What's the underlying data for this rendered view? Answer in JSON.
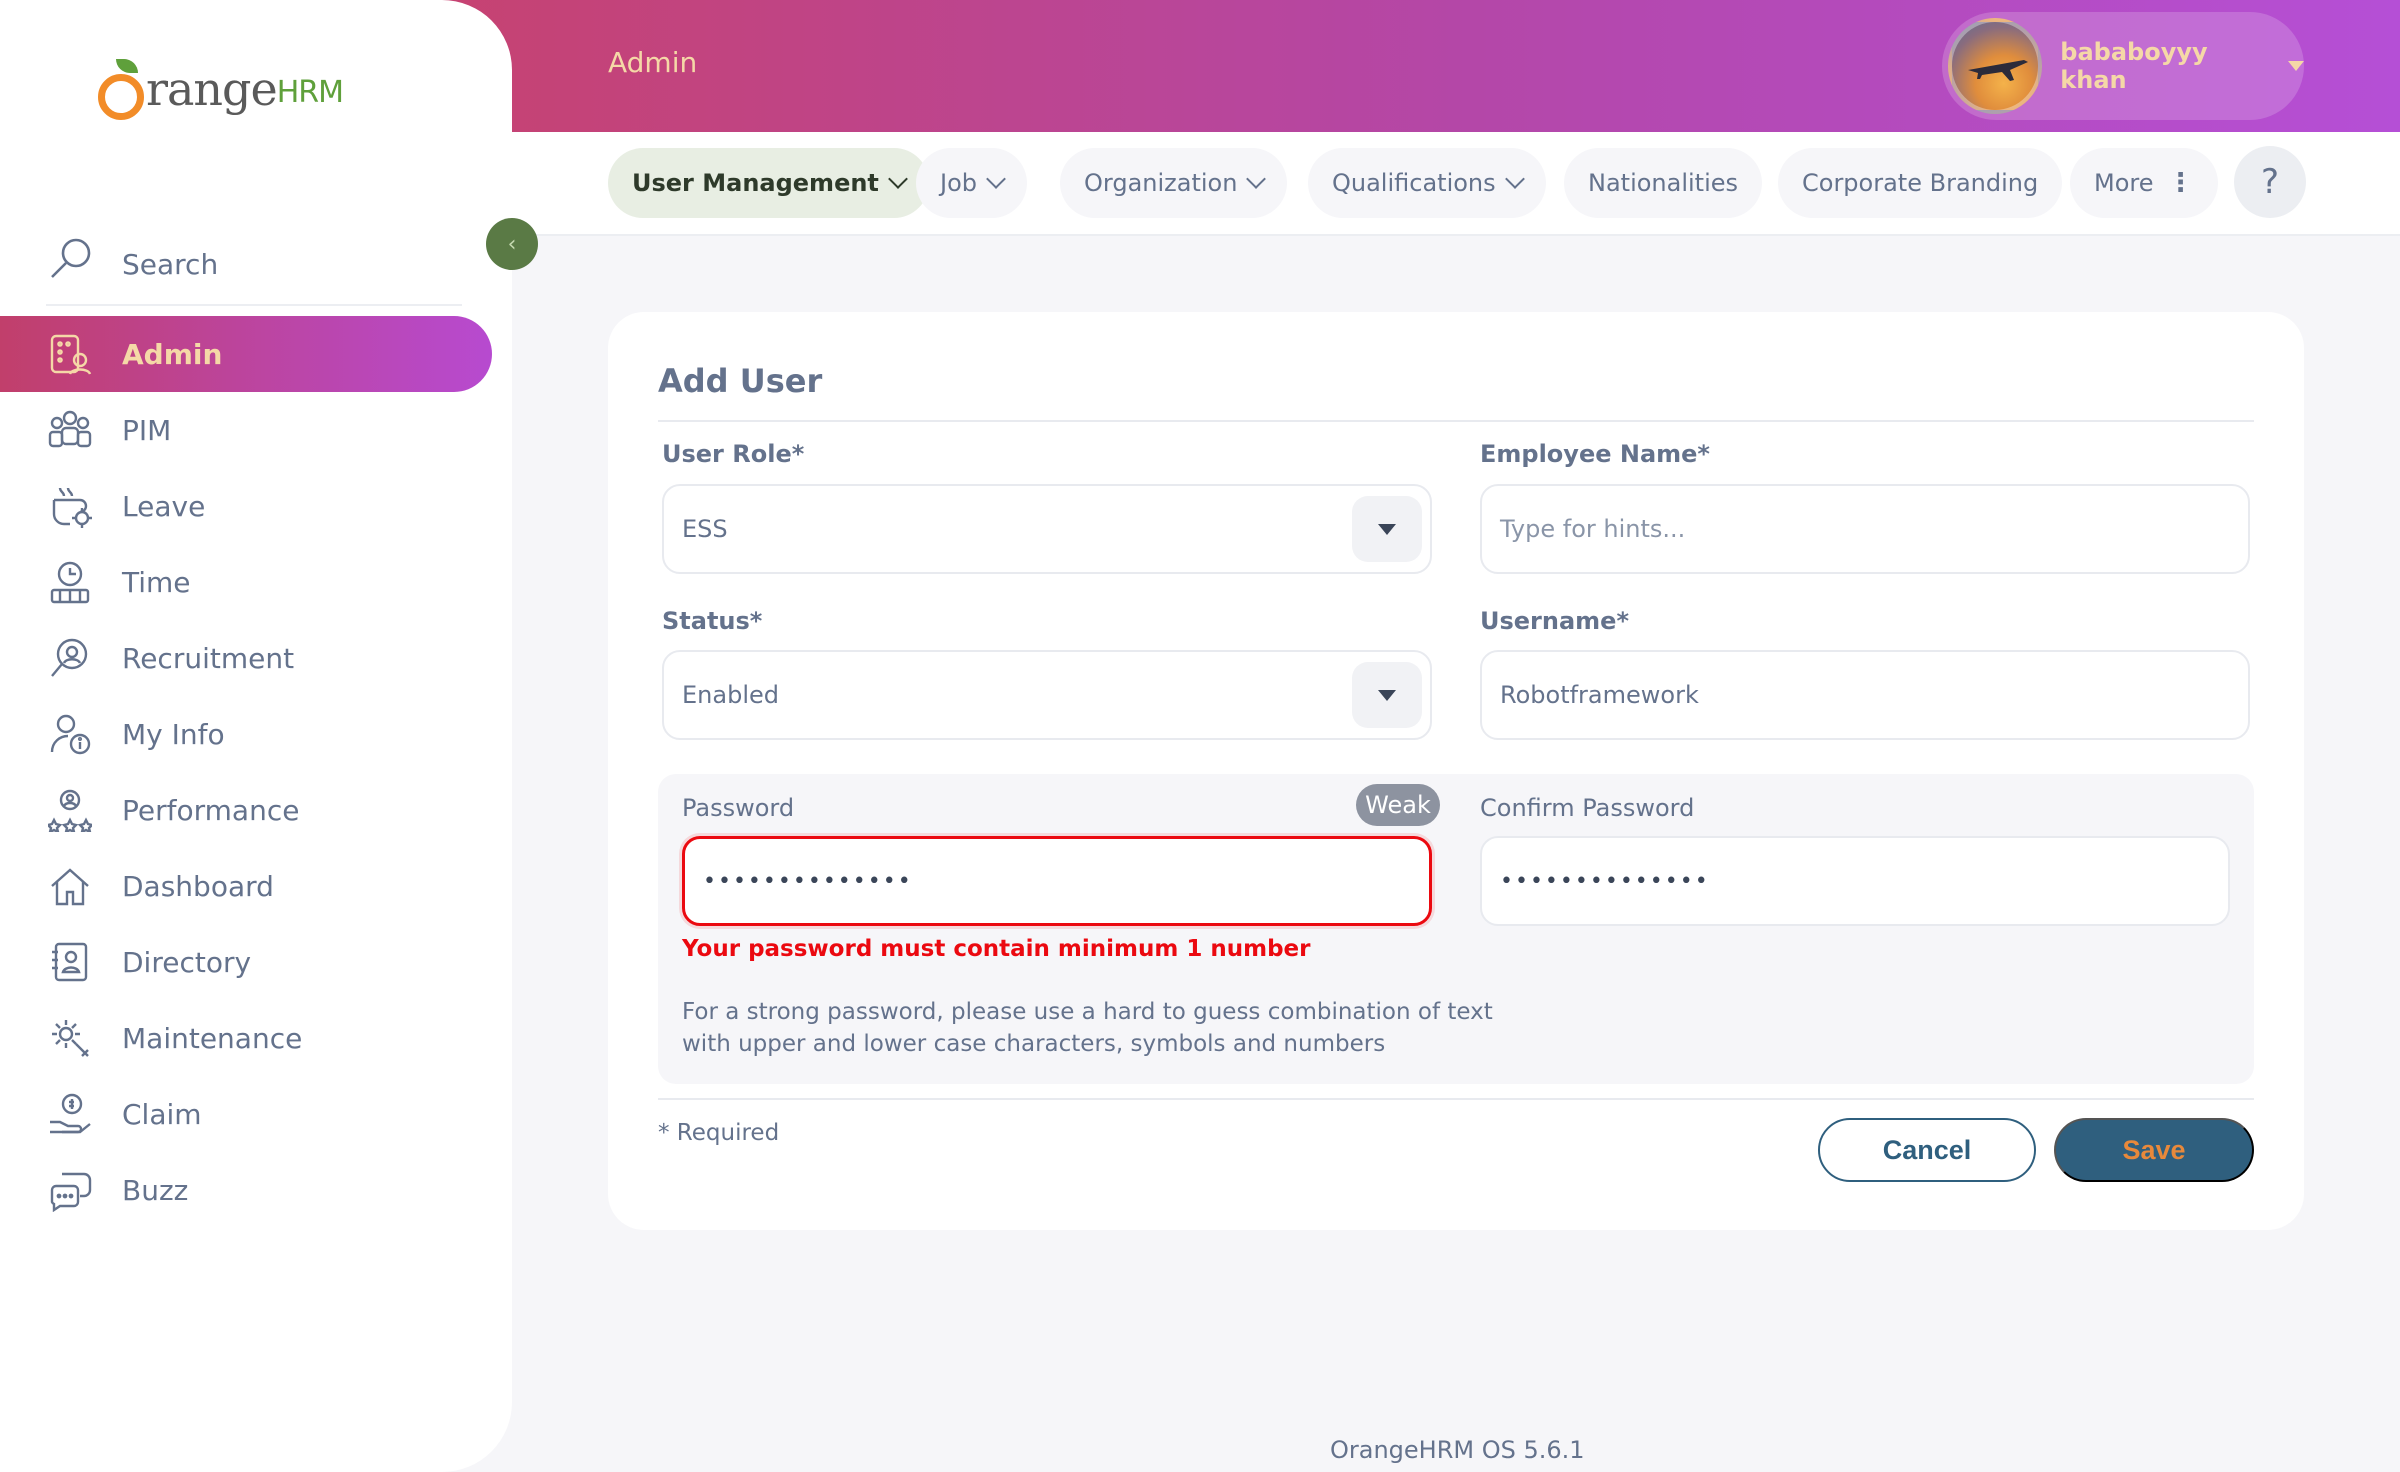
{
  "brand": {
    "main": "range",
    "suffix": "HRM"
  },
  "sidebar": {
    "search_label": "Search",
    "items": [
      {
        "label": "Admin",
        "icon": "admin-icon",
        "active": true
      },
      {
        "label": "PIM",
        "icon": "pim-icon"
      },
      {
        "label": "Leave",
        "icon": "leave-icon"
      },
      {
        "label": "Time",
        "icon": "time-icon"
      },
      {
        "label": "Recruitment",
        "icon": "recruitment-icon"
      },
      {
        "label": "My Info",
        "icon": "my-info-icon"
      },
      {
        "label": "Performance",
        "icon": "performance-icon"
      },
      {
        "label": "Dashboard",
        "icon": "dashboard-icon"
      },
      {
        "label": "Directory",
        "icon": "directory-icon"
      },
      {
        "label": "Maintenance",
        "icon": "maintenance-icon"
      },
      {
        "label": "Claim",
        "icon": "claim-icon"
      },
      {
        "label": "Buzz",
        "icon": "buzz-icon"
      }
    ]
  },
  "header": {
    "title": "Admin",
    "user_name": "bababoyyy khan"
  },
  "tabs": [
    {
      "label": "User Management",
      "dropdown": true,
      "active": true
    },
    {
      "label": "Job",
      "dropdown": true
    },
    {
      "label": "Organization",
      "dropdown": true
    },
    {
      "label": "Qualifications",
      "dropdown": true
    },
    {
      "label": "Nationalities"
    },
    {
      "label": "Corporate Branding"
    },
    {
      "label": "More"
    }
  ],
  "help_label": "?",
  "form": {
    "title": "Add User",
    "user_role": {
      "label": "User Role*",
      "value": "ESS"
    },
    "employee_name": {
      "label": "Employee Name*",
      "placeholder": "Type for hints..."
    },
    "status": {
      "label": "Status*",
      "value": "Enabled"
    },
    "username": {
      "label": "Username*",
      "value": "Robotframework"
    },
    "password": {
      "label": "Password",
      "value": "••••••••••••••",
      "strength": "Weak",
      "error": "Your password must contain minimum 1 number"
    },
    "confirm_password": {
      "label": "Confirm Password",
      "value": "••••••••••••••"
    },
    "hint_line1": "For a strong password, please use a hard to guess combination of text",
    "hint_line2": "with upper and lower case characters, symbols and numbers",
    "required_note": "* Required",
    "cancel_label": "Cancel",
    "save_label": "Save"
  },
  "footer": "OrangeHRM OS 5.6.1",
  "colors": {
    "header_gradient_start": "#c8426c",
    "header_gradient_end": "#b54fd6",
    "accent_text": "#f5d8a7",
    "primary_button": "#2f5f7e",
    "save_text": "#e8893b",
    "error": "#eb0910",
    "collapse_button": "#5a7a45"
  }
}
